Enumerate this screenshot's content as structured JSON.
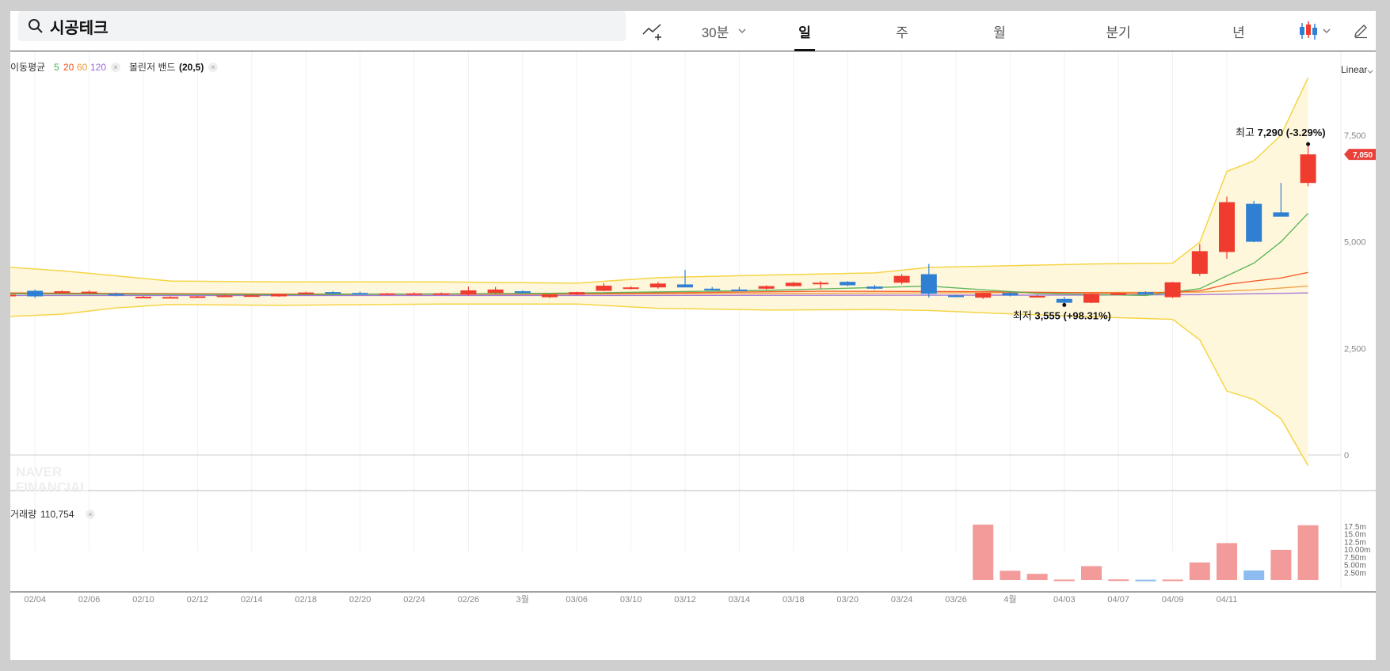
{
  "search": {
    "query": "시공테크"
  },
  "toolbar": {
    "interval_label": "30분",
    "periods": [
      "일",
      "주",
      "월",
      "분기",
      "년"
    ],
    "active_period": "일"
  },
  "indicators": {
    "ma_label": "이동평균",
    "ma_periods": [
      {
        "value": "5",
        "color": "#4caf50"
      },
      {
        "value": "20",
        "color": "#f4511e"
      },
      {
        "value": "60",
        "color": "#ef9a3a"
      },
      {
        "value": "120",
        "color": "#9c6ad6"
      }
    ],
    "bollinger_label": "볼린저 밴드",
    "bollinger_params": "(20,5)",
    "scale_label": "Linear"
  },
  "volume_panel": {
    "label": "거래량",
    "value": "110,754"
  },
  "watermark": [
    "NAVER",
    "FINANCIAL"
  ],
  "colors": {
    "up": "#f03c2e",
    "down": "#2f7fd3",
    "band": "#f5d547",
    "band_fill": "#fff7dc"
  },
  "chart_data": {
    "type": "candlestick",
    "x_labels": [
      "02/04",
      "02/06",
      "02/10",
      "02/12",
      "02/14",
      "02/18",
      "02/20",
      "02/24",
      "02/26",
      "3월",
      "03/06",
      "03/10",
      "03/12",
      "03/14",
      "03/18",
      "03/20",
      "03/24",
      "03/26",
      "4월",
      "04/03",
      "04/07",
      "04/09",
      "04/11"
    ],
    "ylim": [
      0,
      9000
    ],
    "yticks": [
      "0",
      "2,500",
      "5,000",
      "7,500"
    ],
    "current_price": "7,050",
    "current_price_value": 7050,
    "high_annotation": {
      "prefix": "최고",
      "value": "7,290 (-3.29%)",
      "price": 7290,
      "index": 48
    },
    "low_annotation": {
      "prefix": "최저",
      "value": "3,555 (+98.31%)",
      "price": 3555,
      "index": 39
    },
    "candles": [
      [
        3720,
        3850,
        3680,
        3760
      ],
      [
        3850,
        3880,
        3680,
        3720
      ],
      [
        3810,
        3860,
        3790,
        3840
      ],
      [
        3820,
        3860,
        3800,
        3830
      ],
      [
        3780,
        3810,
        3720,
        3740
      ],
      [
        3700,
        3730,
        3680,
        3710
      ],
      [
        3700,
        3720,
        3680,
        3705
      ],
      [
        3700,
        3730,
        3690,
        3720
      ],
      [
        3730,
        3750,
        3720,
        3740
      ],
      [
        3740,
        3760,
        3730,
        3745
      ],
      [
        3720,
        3780,
        3710,
        3770
      ],
      [
        3770,
        3830,
        3760,
        3810
      ],
      [
        3820,
        3840,
        3770,
        3790
      ],
      [
        3800,
        3830,
        3770,
        3780
      ],
      [
        3780,
        3800,
        3760,
        3790
      ],
      [
        3780,
        3810,
        3760,
        3790
      ],
      [
        3780,
        3810,
        3760,
        3790
      ],
      [
        3760,
        3950,
        3740,
        3860
      ],
      [
        3800,
        3940,
        3790,
        3880
      ],
      [
        3840,
        3860,
        3790,
        3800
      ],
      [
        3700,
        3760,
        3680,
        3760
      ],
      [
        3760,
        3830,
        3750,
        3820
      ],
      [
        3850,
        4030,
        3840,
        3970
      ],
      [
        3920,
        3960,
        3880,
        3930
      ],
      [
        3930,
        4060,
        3900,
        4020
      ],
      [
        4000,
        4340,
        3930,
        3930
      ],
      [
        3900,
        3940,
        3860,
        3890
      ],
      [
        3880,
        3940,
        3850,
        3870
      ],
      [
        3900,
        3980,
        3880,
        3960
      ],
      [
        3960,
        4060,
        3950,
        4040
      ],
      [
        4040,
        4080,
        3900,
        4040
      ],
      [
        4060,
        4080,
        3960,
        3980
      ],
      [
        3950,
        3990,
        3880,
        3900
      ],
      [
        4040,
        4250,
        4000,
        4200
      ],
      [
        4240,
        4480,
        3690,
        3780
      ],
      [
        3740,
        3760,
        3700,
        3730
      ],
      [
        3690,
        3810,
        3660,
        3800
      ],
      [
        3800,
        3820,
        3720,
        3740
      ],
      [
        3720,
        3760,
        3690,
        3730
      ],
      [
        3660,
        3710,
        3555,
        3570
      ],
      [
        3570,
        3790,
        3560,
        3780
      ],
      [
        3780,
        3820,
        3760,
        3790
      ],
      [
        3820,
        3840,
        3760,
        3770
      ],
      [
        3700,
        4060,
        3680,
        4050
      ],
      [
        4250,
        4950,
        4200,
        4780
      ],
      [
        4760,
        6060,
        4600,
        5930
      ],
      [
        5890,
        5960,
        4990,
        5000
      ],
      [
        5690,
        6380,
        5640,
        5590
      ],
      [
        6380,
        7290,
        6300,
        7050
      ]
    ],
    "ma5": [
      [
        0,
        3780
      ],
      [
        10,
        3760
      ],
      [
        20,
        3790
      ],
      [
        28,
        3860
      ],
      [
        34,
        3960
      ],
      [
        38,
        3790
      ],
      [
        42,
        3740
      ],
      [
        44,
        3900
      ],
      [
        45,
        4200
      ],
      [
        46,
        4500
      ],
      [
        47,
        5000
      ],
      [
        48,
        5670
      ]
    ],
    "ma20": [
      [
        0,
        3800
      ],
      [
        10,
        3770
      ],
      [
        20,
        3775
      ],
      [
        30,
        3840
      ],
      [
        36,
        3830
      ],
      [
        42,
        3790
      ],
      [
        44,
        3850
      ],
      [
        45,
        4000
      ],
      [
        46,
        4080
      ],
      [
        47,
        4150
      ],
      [
        48,
        4280
      ]
    ],
    "ma60": [
      [
        0,
        3780
      ],
      [
        20,
        3770
      ],
      [
        34,
        3800
      ],
      [
        44,
        3820
      ],
      [
        46,
        3870
      ],
      [
        48,
        3960
      ]
    ],
    "ma120": [
      [
        0,
        3740
      ],
      [
        20,
        3740
      ],
      [
        40,
        3750
      ],
      [
        44,
        3760
      ],
      [
        48,
        3800
      ]
    ],
    "bb_upper": [
      [
        0,
        4400
      ],
      [
        2,
        4320
      ],
      [
        4,
        4200
      ],
      [
        6,
        4080
      ],
      [
        10,
        4060
      ],
      [
        16,
        4060
      ],
      [
        21,
        4030
      ],
      [
        24,
        4160
      ],
      [
        28,
        4220
      ],
      [
        32,
        4270
      ],
      [
        34,
        4400
      ],
      [
        37,
        4440
      ],
      [
        40,
        4480
      ],
      [
        43,
        4500
      ],
      [
        44,
        4990
      ],
      [
        45,
        6650
      ],
      [
        46,
        6900
      ],
      [
        47,
        7500
      ],
      [
        48,
        8850
      ]
    ],
    "bb_lower": [
      [
        0,
        3250
      ],
      [
        2,
        3300
      ],
      [
        4,
        3450
      ],
      [
        6,
        3530
      ],
      [
        10,
        3510
      ],
      [
        16,
        3540
      ],
      [
        21,
        3540
      ],
      [
        24,
        3440
      ],
      [
        28,
        3400
      ],
      [
        32,
        3410
      ],
      [
        34,
        3390
      ],
      [
        37,
        3310
      ],
      [
        40,
        3240
      ],
      [
        43,
        3180
      ],
      [
        44,
        2700
      ],
      [
        45,
        1500
      ],
      [
        46,
        1300
      ],
      [
        47,
        850
      ],
      [
        48,
        -250
      ]
    ],
    "volume": {
      "ylabels": [
        "2.50m",
        "5.00m",
        "7.50m",
        "10.00m",
        "12.5m",
        "15.0m",
        "17.5m"
      ],
      "ymax": 18000000,
      "bars": [
        [
          36,
          20000000,
          "up"
        ],
        [
          37,
          3000000,
          "up"
        ],
        [
          38,
          2000000,
          "up"
        ],
        [
          39,
          150000,
          "up"
        ],
        [
          40,
          4500000,
          "up"
        ],
        [
          41,
          200000,
          "up"
        ],
        [
          42,
          100000,
          "down"
        ],
        [
          43,
          150000,
          "up"
        ],
        [
          44,
          5700000,
          "up"
        ],
        [
          45,
          12000000,
          "up"
        ],
        [
          46,
          3100000,
          "down"
        ],
        [
          47,
          9800000,
          "up"
        ],
        [
          48,
          17800000,
          "up"
        ]
      ]
    }
  }
}
